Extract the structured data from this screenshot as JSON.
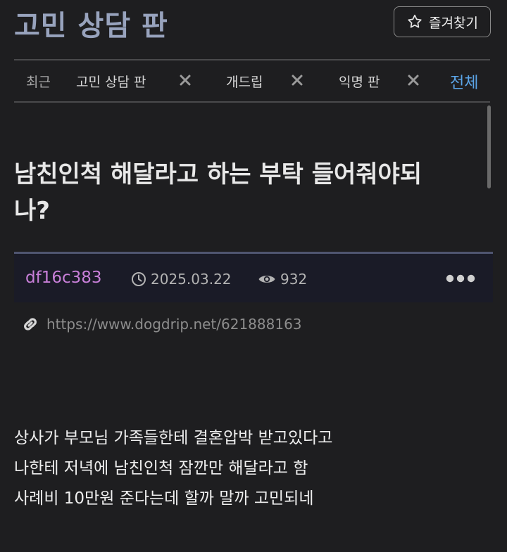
{
  "header": {
    "board_title": "고민 상담 판",
    "favorite_label": "즐겨찾기",
    "favorite_icon": "star-outline-icon"
  },
  "tabs": {
    "recent_label": "최근",
    "items": [
      {
        "label": "고민 상담 판"
      },
      {
        "label": "개드립"
      },
      {
        "label": "익명 판"
      }
    ],
    "all_label": "전체"
  },
  "post": {
    "title_line1": "남친인척 해달라고 하는 부탁 들어줘야되",
    "title_line2": "나?",
    "author": "df16c383",
    "date": "2025.03.22",
    "views": "932",
    "link": "https://www.dogdrip.net/621888163",
    "body": [
      "상사가 부모님 가족들한테 결혼압박 받고있다고",
      "나한테 저녁에 남친인척 잠깐만 해달라고 함",
      "사례비 10만원 준다는데 할까 말까 고민되네"
    ]
  },
  "colors": {
    "background": "#1e1e20",
    "board_title": "#98a3bd",
    "author": "#c87fd8",
    "accent_link": "#5ba5e8",
    "meta_bar": "#1a1b27"
  }
}
